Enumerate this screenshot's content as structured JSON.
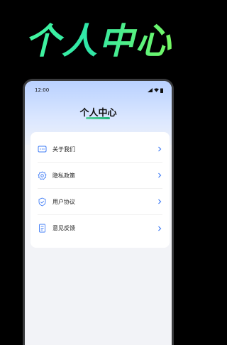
{
  "promo": {
    "title": "个人中心"
  },
  "status_bar": {
    "time": "12:00"
  },
  "header": {
    "title": "个人中心"
  },
  "menu": {
    "items": [
      {
        "label": "关于我们",
        "icon": "message-dots-icon"
      },
      {
        "label": "隐私政策",
        "icon": "gear-icon"
      },
      {
        "label": "用户协议",
        "icon": "shield-check-icon"
      },
      {
        "label": "意见反馈",
        "icon": "feedback-doc-icon"
      }
    ]
  },
  "colors": {
    "accent": "#3f7cf6",
    "promo_green": "#4dff9a",
    "header_blue": "#b9d1ff"
  }
}
